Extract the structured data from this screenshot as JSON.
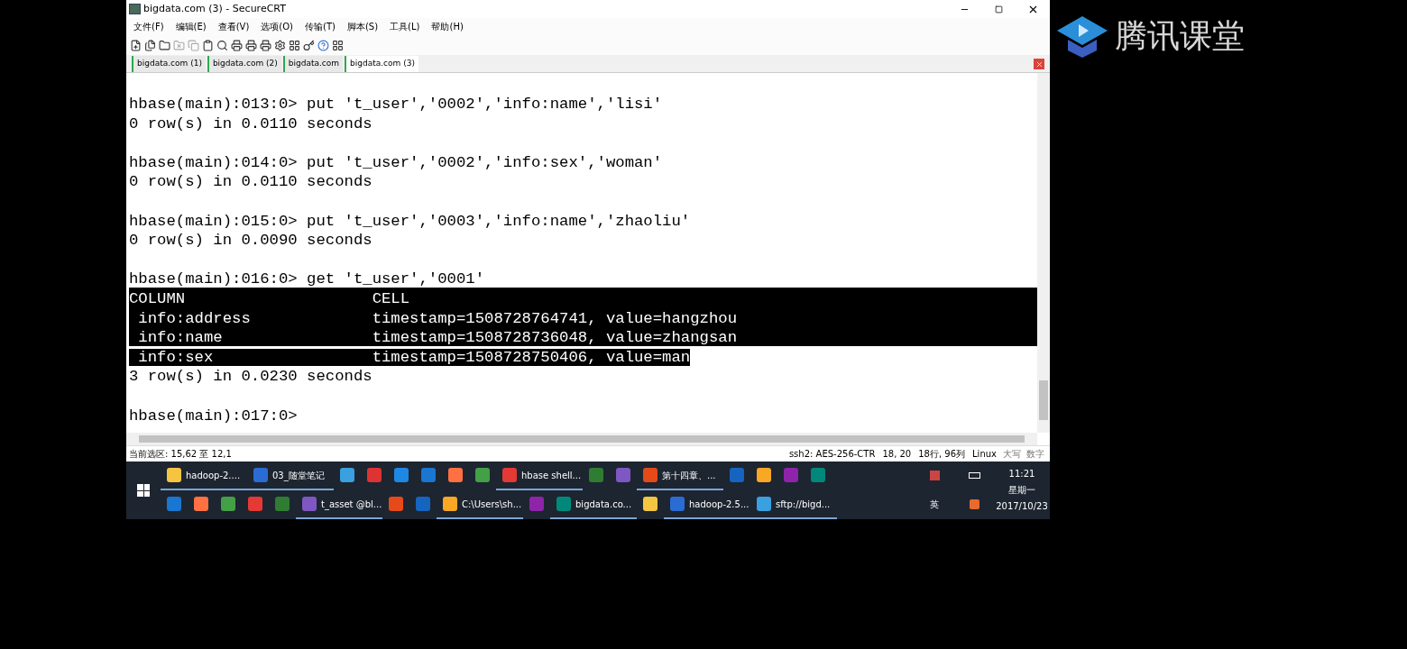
{
  "window": {
    "title": "bigdata.com (3) - SecureCRT"
  },
  "menu": [
    "文件(F)",
    "编辑(E)",
    "查看(V)",
    "选项(O)",
    "传输(T)",
    "脚本(S)",
    "工具(L)",
    "帮助(H)"
  ],
  "tabs": [
    {
      "label": "bigdata.com (1)",
      "selected": false
    },
    {
      "label": "bigdata.com (2)",
      "selected": false
    },
    {
      "label": "bigdata.com",
      "selected": false
    },
    {
      "label": "bigdata.com (3)",
      "selected": true
    }
  ],
  "terminal": {
    "lines": [
      {
        "text": "hbase(main):013:0> put 't_user','0002','info:name','lisi'"
      },
      {
        "text": "0 row(s) in 0.0110 seconds"
      },
      {
        "blank": true
      },
      {
        "text": "hbase(main):014:0> put 't_user','0002','info:sex','woman'"
      },
      {
        "text": "0 row(s) in 0.0110 seconds"
      },
      {
        "blank": true
      },
      {
        "text": "hbase(main):015:0> put 't_user','0003','info:name','zhaoliu'"
      },
      {
        "text": "0 row(s) in 0.0090 seconds"
      },
      {
        "blank": true
      },
      {
        "text": "hbase(main):016:0> get 't_user','0001'"
      },
      {
        "text": "COLUMN                    CELL",
        "selected": true
      },
      {
        "text": " info:address             timestamp=1508728764741, value=hangzhou",
        "selected": true
      },
      {
        "text": " info:name                timestamp=1508728736048, value=zhangsan",
        "selected": true
      },
      {
        "text": " info:sex                 timestamp=1508728750406, value=man",
        "selected": true
      },
      {
        "text": "3 row(s) in 0.0230 seconds"
      },
      {
        "blank": true
      },
      {
        "text": "hbase(main):017:0>"
      }
    ]
  },
  "status_bar": {
    "left": "当前选区: 15,62 至 12,1",
    "items": [
      "ssh2: AES-256-CTR",
      "18, 20",
      "18行, 96列",
      "Linux"
    ],
    "indicators": [
      "大写",
      "数字"
    ]
  },
  "taskbar": {
    "rows": [
      [
        {
          "label": "hadoop-2....",
          "open": true
        },
        {
          "label": "03_随堂笔记",
          "open": true
        },
        {
          "open": false
        },
        {
          "open": false
        },
        {
          "open": false
        },
        {
          "open": false
        },
        {
          "open": false
        },
        {
          "open": false
        },
        {
          "label": "hbase shell...",
          "open": true
        },
        {
          "open": false
        },
        {
          "open": false
        },
        {
          "label": "第十四章、...",
          "open": true
        },
        {
          "open": false
        },
        {
          "open": false
        },
        {
          "open": false
        },
        {
          "open": false
        }
      ],
      [
        {
          "open": false
        },
        {
          "open": false
        },
        {
          "open": false
        },
        {
          "open": false
        },
        {
          "open": false
        },
        {
          "label": "t_asset @bl...",
          "open": true
        },
        {
          "open": false
        },
        {
          "open": false
        },
        {
          "label": "C:\\Users\\sh...",
          "open": true
        },
        {
          "open": false
        },
        {
          "label": "bigdata.co...",
          "open": true
        },
        {
          "open": false
        },
        {
          "label": "hadoop-2.5...",
          "open": true
        },
        {
          "label": "sftp://bigd...",
          "open": true
        }
      ]
    ],
    "tray": {
      "ime": "英",
      "time": "11:21",
      "weekday": "星期一",
      "date": "2017/10/23"
    }
  },
  "logo": {
    "text": "腾讯课堂"
  }
}
